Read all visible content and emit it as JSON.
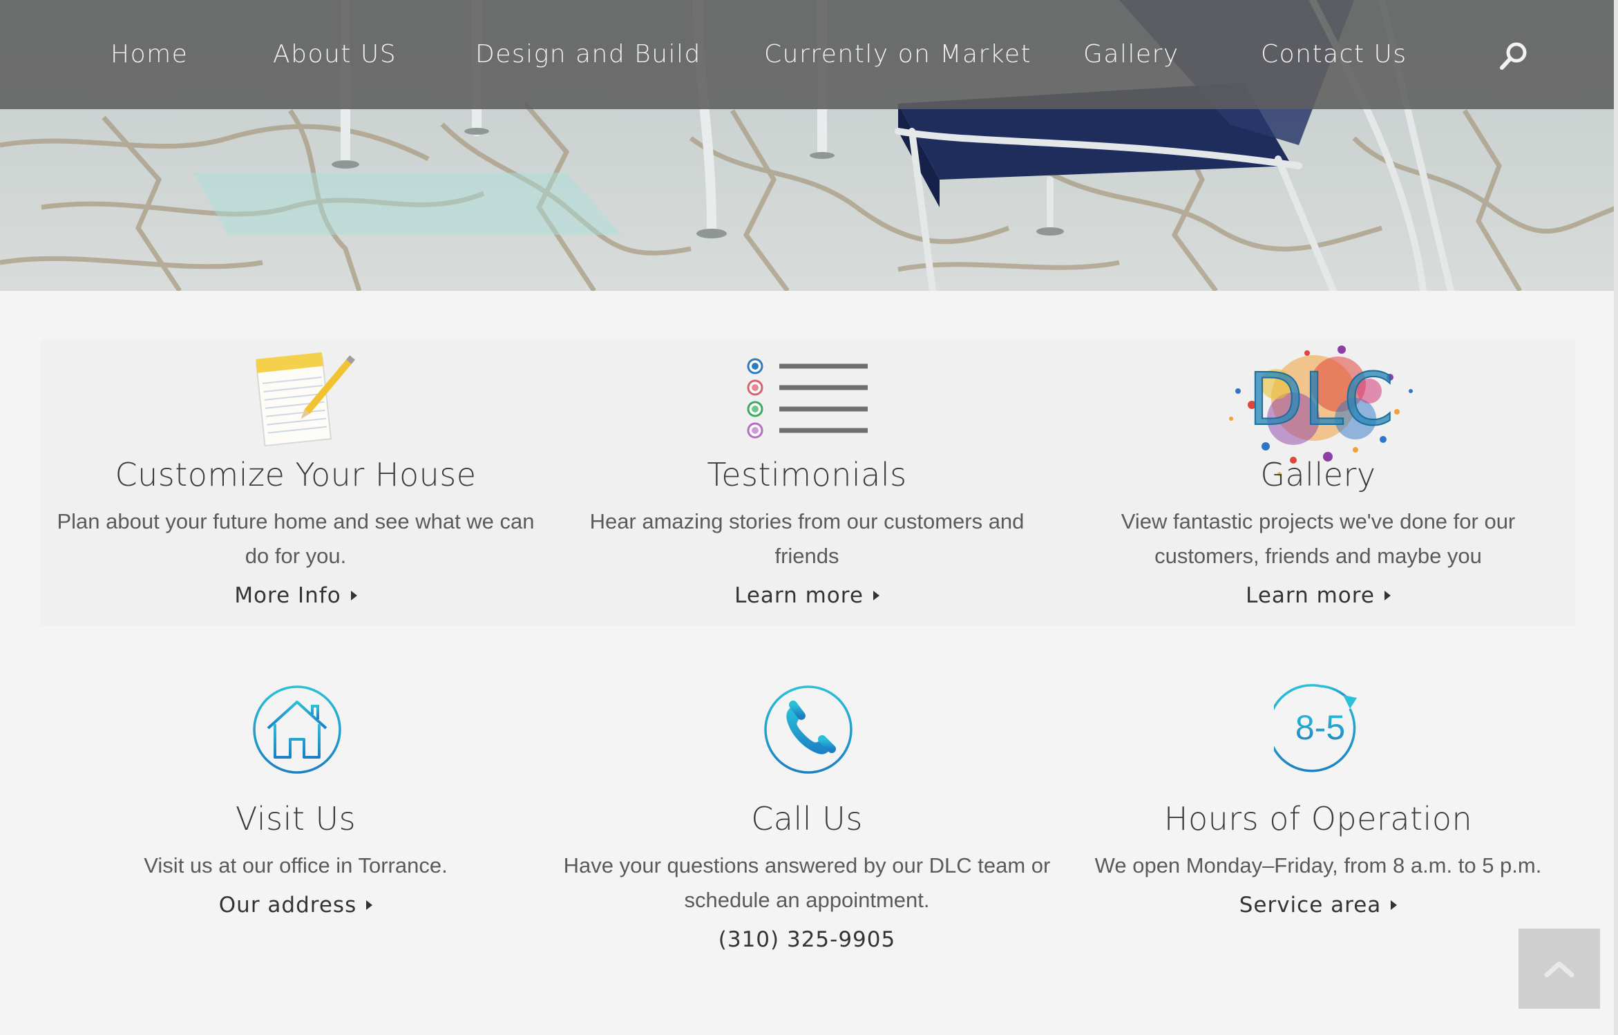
{
  "nav": {
    "items": [
      "Home",
      "About US",
      "Design and Build",
      "Currently on Market",
      "Gallery",
      "Contact Us"
    ]
  },
  "features": [
    {
      "icon": "notepad-icon",
      "title": "Customize Your House",
      "text_line1": "Plan about your future home and see what we can",
      "text_line2": "do for you.",
      "link": "More Info"
    },
    {
      "icon": "list-icon",
      "title": "Testimonials",
      "text_line1": "Hear amazing stories from our customers and",
      "text_line2": "friends",
      "link": "Learn more"
    },
    {
      "icon": "dlc-logo",
      "title": "Gallery",
      "text_line1": "View fantastic projects we've done for our",
      "text_line2": "customers, friends and maybe you",
      "link": "Learn more"
    }
  ],
  "contact": [
    {
      "icon": "house-icon",
      "title": "Visit Us",
      "text_line1": "Visit us at our office in Torrance.",
      "link": "Our address"
    },
    {
      "icon": "phone-icon",
      "title": "Call Us",
      "text_line1": "Have your questions answered by our DLC team or",
      "text_line2": "schedule an appointment.",
      "phone": "(310) 325-9905"
    },
    {
      "icon": "clock-icon",
      "title": "Hours of Operation",
      "text_line1": "We open Monday–Friday, from 8 a.m. to 5 p.m.",
      "link": "Service area",
      "badge": "8-5"
    }
  ],
  "logo_text": "DLC",
  "colors": {
    "accent": "#1aa0c8",
    "nav_bg": "#5f5f5f",
    "page_bg": "#f4f4f4"
  }
}
